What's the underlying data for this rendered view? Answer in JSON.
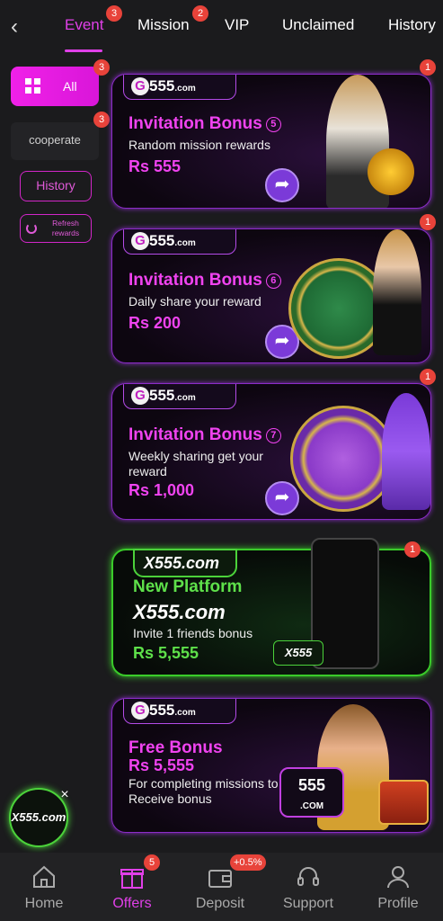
{
  "top_tabs": [
    {
      "label": "Event",
      "badge": "3",
      "active": true
    },
    {
      "label": "Mission",
      "badge": "2"
    },
    {
      "label": "VIP"
    },
    {
      "label": "Unclaimed"
    },
    {
      "label": "History"
    }
  ],
  "sidebar": {
    "all": {
      "label": "All",
      "badge": "3"
    },
    "cooperate": {
      "label": "cooperate",
      "badge": "3"
    },
    "history": {
      "label": "History"
    },
    "refresh": {
      "label": "Refresh rewards"
    }
  },
  "cards": [
    {
      "badge": "1",
      "logo": "555",
      "logo_suffix": ".com",
      "title": "Invitation Bonus",
      "num": "5",
      "subtitle": "Random mission rewards",
      "amount": "Rs 555"
    },
    {
      "badge": "1",
      "logo": "555",
      "logo_suffix": ".com",
      "title": "Invitation Bonus",
      "num": "6",
      "subtitle": "Daily share your reward",
      "amount": "Rs  200"
    },
    {
      "badge": "1",
      "logo": "555",
      "logo_suffix": ".com",
      "title": "Invitation Bonus",
      "num": "7",
      "subtitle": "Weekly sharing get your reward",
      "amount": "Rs  1,000"
    }
  ],
  "green_card": {
    "badge": "1",
    "logo": "X555.com",
    "title": "New Platform",
    "brand": "X555.com",
    "subtitle": "Invite 1 friends bonus",
    "amount": "Rs 5,555",
    "phone_logo": "X555"
  },
  "free_card": {
    "logo": "555",
    "logo_suffix": ".com",
    "title": "Free Bonus",
    "amount": "Rs  5,555",
    "subtitle": "For completing missions to Receive bonus",
    "badge_logo": "555",
    "badge_logo_suffix": ".COM"
  },
  "fab": {
    "label": "X555.com",
    "close": "×"
  },
  "bottom_nav": [
    {
      "label": "Home",
      "icon": "home-icon"
    },
    {
      "label": "Offers",
      "icon": "gift-icon",
      "badge": "5",
      "active": true
    },
    {
      "label": "Deposit",
      "icon": "wallet-icon",
      "badge": "+0.5%"
    },
    {
      "label": "Support",
      "icon": "headset-icon"
    },
    {
      "label": "Profile",
      "icon": "person-icon"
    }
  ],
  "colors": {
    "accent": "#e040e8",
    "green": "#4bd23a",
    "badge": "#e8433a"
  }
}
